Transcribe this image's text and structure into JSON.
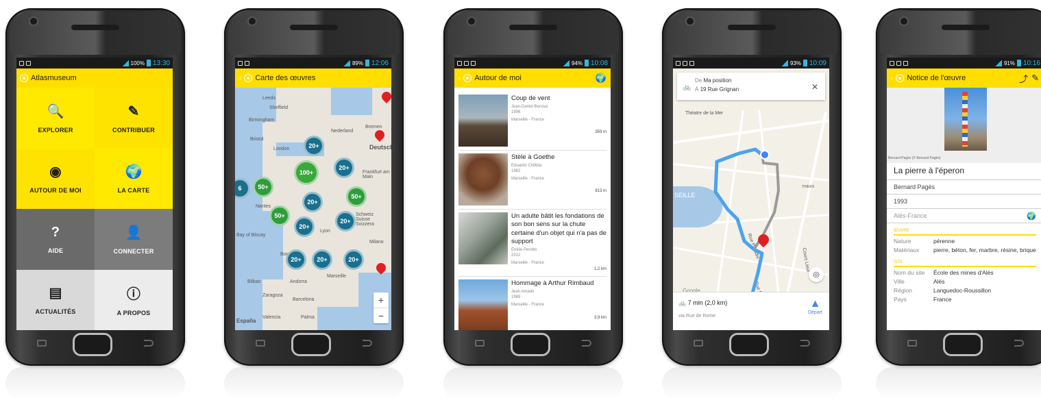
{
  "phone1": {
    "status": {
      "battery": "100%",
      "time": "13:30"
    },
    "appbar_title": "Atlasmuseum",
    "tiles": [
      {
        "label": "EXPLORER",
        "icon": "🔍"
      },
      {
        "label": "CONTRIBUER",
        "icon": "✎"
      },
      {
        "label": "AUTOUR DE MOI",
        "icon": "◉"
      },
      {
        "label": "LA CARTE",
        "icon": "🌍"
      },
      {
        "label": "AIDE",
        "icon": "?"
      },
      {
        "label": "CONNECTER",
        "icon": "👤"
      },
      {
        "label": "ACTUALITÉS",
        "icon": "▤"
      },
      {
        "label": "A PROPOS",
        "icon": "ⓘ"
      }
    ]
  },
  "phone2": {
    "status": {
      "battery": "89%",
      "time": "12:06"
    },
    "appbar_title": "Carte des œuvres",
    "labels": [
      "Leeds",
      "Sheffield",
      "Birmingham",
      "Bristol",
      "London",
      "Nederland",
      "Bremen",
      "Deutsch",
      "Frankfurt am Main",
      "Nantes",
      "Bay of Biscay",
      "Lyon",
      "Schweiz Suisse Svizzera",
      "Milano",
      "Bordeaux",
      "Marseille",
      "Bilbao",
      "Andorra",
      "Zaragoza",
      "Barcelona",
      "España",
      "Valencia",
      "Palma"
    ],
    "clusters": [
      "20+",
      "100+",
      "20+",
      "50+",
      "6",
      "50+",
      "20+",
      "50+",
      "20+",
      "20+",
      "20+",
      "20+",
      "20+"
    ],
    "zoom_in": "+",
    "zoom_out": "−"
  },
  "phone3": {
    "status": {
      "battery": "94%",
      "time": "10:08"
    },
    "appbar_title": "Autour de moi",
    "items": [
      {
        "title": "Coup de vent",
        "artist": "Jean-Daniel Berclaz",
        "year": "1996",
        "location": "Marseille - France",
        "distance": "359 m"
      },
      {
        "title": "Stèle à Goethe",
        "artist": "Eduardo Chillida",
        "year": "1982",
        "location": "Marseille - France",
        "distance": "813 m"
      },
      {
        "title": "Un adulte bâtit les fondations de son bon sens sur la chute certaine d'un objet qui n'a pas de support",
        "artist": "Émilie Perotto",
        "year": "2012",
        "location": "Marseille - France",
        "distance": "1,2 km"
      },
      {
        "title": "Hommage à Arthur Rimbaud",
        "artist": "Jean Amado",
        "year": "1989",
        "location": "Marseille - France",
        "distance": "3,9 km"
      }
    ]
  },
  "phone4": {
    "status": {
      "battery": "93%",
      "time": "10:09"
    },
    "from_label": "De",
    "from_value": "Ma position",
    "to_label": "À",
    "to_value": "19 Rue Grignan",
    "map_labels": [
      "Théatre de la Mer",
      "SEILLE",
      "Rue Paradis",
      "Cours Lieut",
      "Rue Bre",
      "THIERS",
      "Google"
    ],
    "duration": "7 min (2,0 km)",
    "via": "via Rue de Rome",
    "start_label": "Départ"
  },
  "phone5": {
    "status": {
      "battery": "91%",
      "time": "10:16"
    },
    "appbar_title": "Notice de l'œuvre",
    "photo_credit": "Bernard Pagès (© Bernard Pagès)",
    "title": "La pierre à l'éperon",
    "artist": "Bernard Pagès",
    "year": "1993",
    "place": "Alès-France",
    "section_oeuvre": "ŒUVRE",
    "nature_label": "Nature",
    "nature_value": "pérenne",
    "materials_label": "Matériaux",
    "materials_value": "pierre, béton, fer, marbre, résine, brique",
    "section_site": "SITE",
    "site_name_label": "Nom du site",
    "site_name_value": "École des mines d'Alès",
    "city_label": "Ville",
    "city_value": "Alès",
    "region_label": "Région",
    "region_value": "Languedoc-Roussillon",
    "country_label": "Pays",
    "country_value": "France"
  },
  "colors": {
    "accent": "#ffde00",
    "status_blue": "#33b5e5",
    "cluster_blue": "#1a6f8f",
    "cluster_green": "#2e9d3a",
    "route_blue": "#4aa3f0"
  }
}
